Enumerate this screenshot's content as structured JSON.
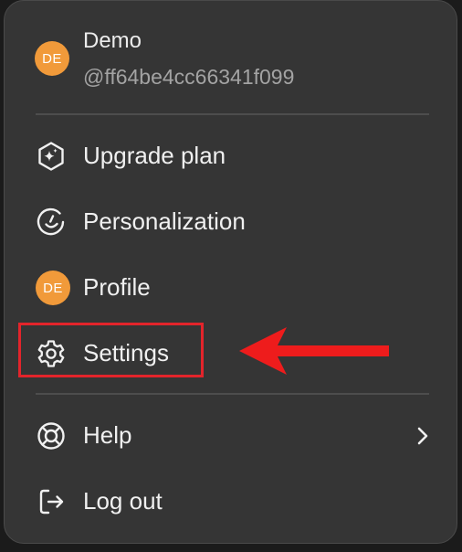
{
  "user": {
    "avatar_initials": "DE",
    "name": "Demo",
    "handle": "@ff64be4cc66341f099",
    "avatar_color": "#f19a3a"
  },
  "menu": {
    "items": [
      {
        "label": "Upgrade plan",
        "icon": "sparkle-hexagon-icon"
      },
      {
        "label": "Personalization",
        "icon": "personalization-icon"
      },
      {
        "label": "Profile",
        "icon": "avatar",
        "avatar_initials": "DE"
      },
      {
        "label": "Settings",
        "icon": "gear-icon"
      },
      {
        "label": "Help",
        "icon": "lifebuoy-icon",
        "has_submenu": true
      },
      {
        "label": "Log out",
        "icon": "logout-icon"
      }
    ]
  },
  "annotations": {
    "highlight_color": "#e3242b",
    "highlighted_item": "Settings"
  },
  "colors": {
    "menu_background": "#353535",
    "text": "#f0f0f0",
    "muted_text": "#a3a3a3"
  }
}
